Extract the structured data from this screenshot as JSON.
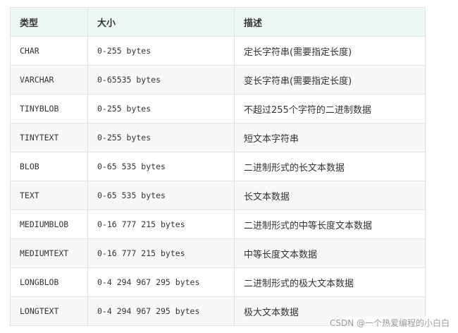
{
  "table": {
    "headers": [
      "类型",
      "大小",
      "描述"
    ],
    "rows": [
      {
        "type": "CHAR",
        "size": "0-255 bytes",
        "desc": "定长字符串(需要指定长度)"
      },
      {
        "type": "VARCHAR",
        "size": "0-65535 bytes",
        "desc": "变长字符串(需要指定长度)"
      },
      {
        "type": "TINYBLOB",
        "size": "0-255 bytes",
        "desc": "不超过255个字符的二进制数据"
      },
      {
        "type": "TINYTEXT",
        "size": "0-255 bytes",
        "desc": "短文本字符串"
      },
      {
        "type": "BLOB",
        "size": "0-65 535 bytes",
        "desc": "二进制形式的长文本数据"
      },
      {
        "type": "TEXT",
        "size": "0-65 535 bytes",
        "desc": "长文本数据"
      },
      {
        "type": "MEDIUMBLOB",
        "size": "0-16 777 215 bytes",
        "desc": "二进制形式的中等长度文本数据"
      },
      {
        "type": "MEDIUMTEXT",
        "size": "0-16 777 215 bytes",
        "desc": "中等长度文本数据"
      },
      {
        "type": "LONGBLOB",
        "size": "0-4 294 967 295 bytes",
        "desc": "二进制形式的极大文本数据"
      },
      {
        "type": "LONGTEXT",
        "size": "0-4 294 967 295 bytes",
        "desc": "极大文本数据"
      }
    ]
  },
  "watermark": "CSDN @一个热爱编程的小白白"
}
